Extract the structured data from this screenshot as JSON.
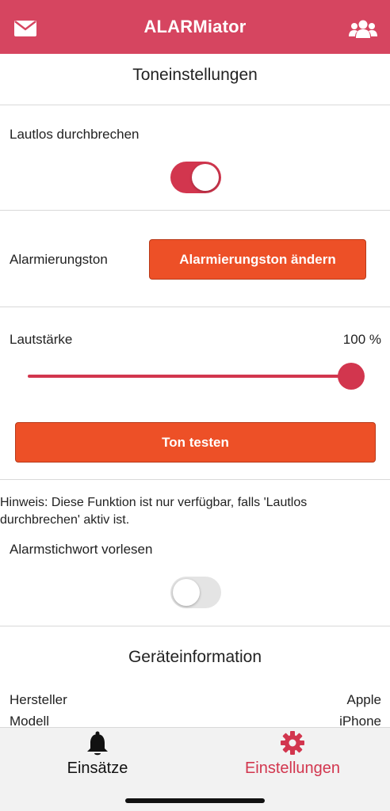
{
  "header": {
    "title": "ALARMiator",
    "left_icon": "mail-icon",
    "right_icon": "group-icon",
    "color": "#d64560"
  },
  "tone_settings": {
    "title": "Toneinstellungen",
    "silent_override": {
      "label": "Lautlos durchbrechen",
      "enabled": true
    },
    "alarm_tone": {
      "label": "Alarmierungston",
      "button_label": "Alarmierungston ändern"
    },
    "volume": {
      "label": "Lautstärke",
      "value_text": "100 %",
      "level": 1.0
    },
    "test_button_label": "Ton testen",
    "hint": "Hinweis: Diese Funktion ist nur verfügbar, falls 'Lautlos durchbrechen' aktiv ist.",
    "read_keyword": {
      "label": "Alarmstichwort vorlesen",
      "enabled": false
    }
  },
  "device_info": {
    "title": "Geräteinformation",
    "rows": [
      {
        "label": "Hersteller",
        "value": "Apple"
      },
      {
        "label": "Modell",
        "value": "iPhone"
      }
    ]
  },
  "tabbar": {
    "tabs": [
      {
        "label": "Einsätze",
        "icon": "bell-icon",
        "active": false
      },
      {
        "label": "Einstellungen",
        "icon": "gear-icon",
        "active": true
      }
    ]
  },
  "colors": {
    "accent": "#d2364e",
    "button": "#ed5027"
  }
}
